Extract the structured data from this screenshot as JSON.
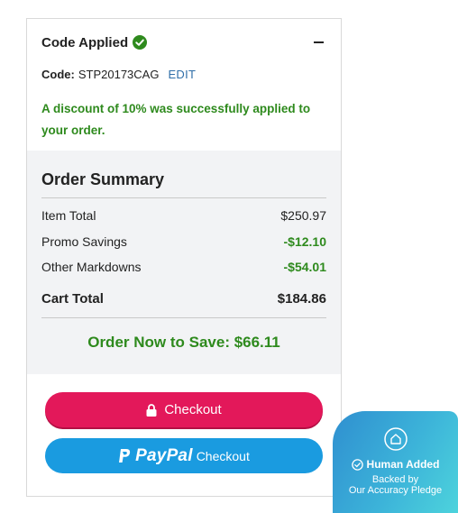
{
  "promo": {
    "title": "Code Applied",
    "code_label": "Code:",
    "code_value": "STP20173CAG",
    "edit_label": "EDIT",
    "message": "A discount of 10% was successfully applied to your order."
  },
  "summary": {
    "title": "Order Summary",
    "rows": [
      {
        "label": "Item Total",
        "value": "$250.97"
      },
      {
        "label": "Promo Savings",
        "value": "-$12.10"
      },
      {
        "label": "Other Markdowns",
        "value": "-$54.01"
      }
    ],
    "total_label": "Cart Total",
    "total_value": "$184.86",
    "save_message": "Order Now to Save: $66.11"
  },
  "buttons": {
    "checkout_label": "Checkout",
    "paypal_word": "PayPal",
    "paypal_label": "Checkout"
  },
  "badge": {
    "title": "Human Added",
    "line1": "Backed by",
    "line2": "Our Accuracy Pledge"
  },
  "colors": {
    "success_green": "#2e8a1d",
    "checkout_pink": "#e3185a",
    "paypal_blue": "#1a9be0",
    "edit_link_blue": "#2f6ea8"
  },
  "icons": [
    "check-circle-icon",
    "minus-icon",
    "lock-icon",
    "paypal-p-icon",
    "house-icon",
    "check-circle-outline-icon"
  ]
}
